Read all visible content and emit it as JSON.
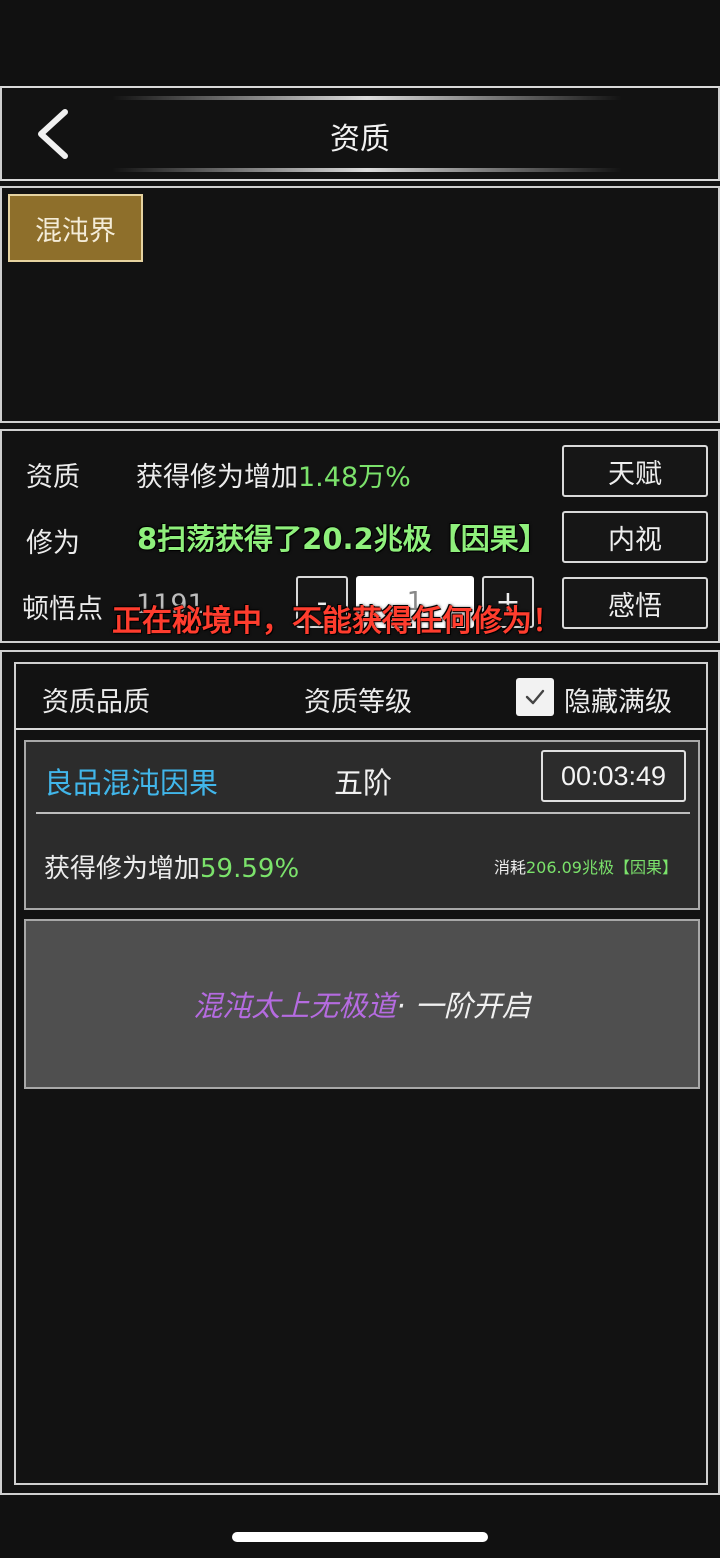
{
  "header": {
    "title": "资质"
  },
  "realm": {
    "tab_label": "混沌界"
  },
  "stats": {
    "aptitude_label": "资质",
    "aptitude_prefix": "获得修为增加",
    "aptitude_value": "1.48万%",
    "cultivation_label": "修为",
    "cultivation_value": "8扫荡获得了20.2兆极【因果】",
    "insight_label": "顿悟点",
    "insight_value": "1191",
    "insight_input": "1",
    "minus_label": "-",
    "plus_label": "+",
    "talent_button": "天赋",
    "inner_view_button": "内视",
    "comprehend_button": "感悟"
  },
  "toasts": {
    "sweep_message": "扫荡获得了20.2兆极【因果】",
    "warning_message": "正在秘境中，不能获得任何修为！"
  },
  "list": {
    "col_quality": "资质品质",
    "col_level": "资质等级",
    "hide_max_label": "隐藏满级",
    "hide_max_checked": true,
    "items": [
      {
        "name": "良品混沌因果",
        "tier": "五阶",
        "timer": "00:03:49",
        "effect_prefix": "获得修为增加",
        "effect_value": "59.59%",
        "cost_prefix": "消耗",
        "cost_value": "206.09兆极",
        "cost_suffix": "【因果】"
      }
    ],
    "next_unlock": {
      "name": "混沌太上无极道",
      "suffix": "· 一阶开启"
    }
  },
  "colors": {
    "accent_gold": "#8e6f2b",
    "value_green": "#7be26b",
    "item_blue": "#41b6ea",
    "unlock_purple": "#b56be0",
    "warning_red": "#ff3d2e"
  }
}
